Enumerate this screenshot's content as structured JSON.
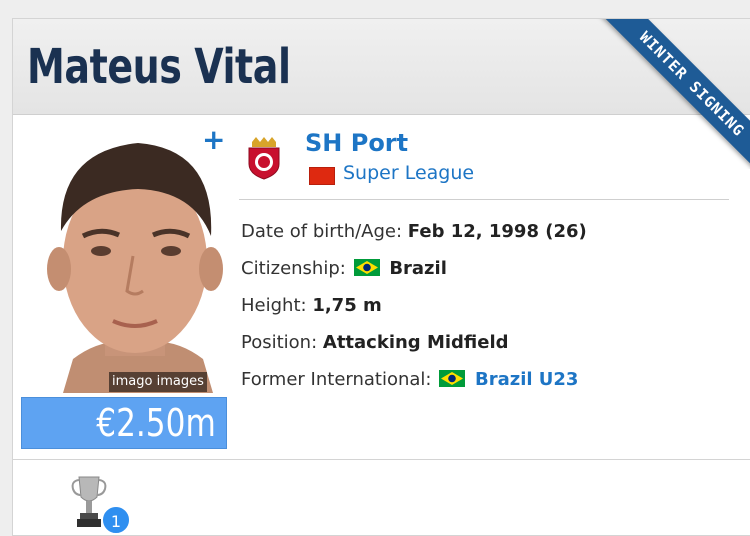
{
  "header": {
    "player_name": "Mateus Vital",
    "ribbon_label": "WINTER SIGNING"
  },
  "profile": {
    "photo_credit": "imago images",
    "add_label": "+",
    "market_value": "€2.50m"
  },
  "club": {
    "name": "SH Port",
    "league": "Super League",
    "league_flag": "china-flag-icon"
  },
  "info": {
    "dob_label": "Date of birth/Age:",
    "dob_value": "Feb 12, 1998 (26)",
    "citizenship_label": "Citizenship:",
    "citizenship_value": "Brazil",
    "height_label": "Height:",
    "height_value": "1,75 m",
    "position_label": "Position:",
    "position_value": "Attacking Midfield",
    "former_intl_label": "Former International:",
    "former_intl_value": "Brazil U23"
  },
  "achievements": {
    "trophy_icon": "trophy-icon",
    "count": "1"
  },
  "colors": {
    "title": "#1a3151",
    "link": "#1d75c5",
    "ribbon": "#1e5b96",
    "market_value_bg": "#5ea3f2"
  }
}
